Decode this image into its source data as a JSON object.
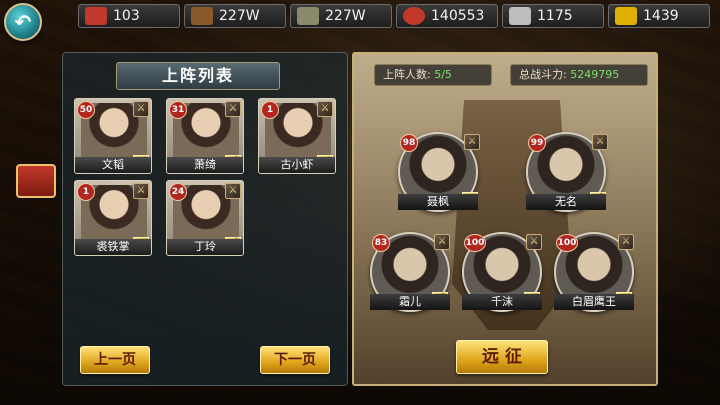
{
  "resources": [
    {
      "icon": "scroll-icon",
      "color": "#c0392b",
      "value": "103"
    },
    {
      "icon": "wood-icon",
      "color": "#8b5a2b",
      "value": "227W"
    },
    {
      "icon": "stone-icon",
      "color": "#8a8a6a",
      "value": "227W"
    },
    {
      "icon": "meat-icon",
      "color": "#c0392b",
      "value": "140553"
    },
    {
      "icon": "silver-ingot-icon",
      "color": "#bdbdbd",
      "value": "1175"
    },
    {
      "icon": "gold-ingot-icon",
      "color": "#e0b000",
      "value": "1439"
    }
  ],
  "left_panel": {
    "title": "上阵列表",
    "prev_page": "上一页",
    "next_page": "下一页",
    "heroes": [
      {
        "name": "文韬",
        "level": "50"
      },
      {
        "name": "萧绮",
        "level": "31"
      },
      {
        "name": "古小虾",
        "level": "1"
      },
      {
        "name": "裘铁掌",
        "level": "1"
      },
      {
        "name": "丁玲",
        "level": "24"
      }
    ]
  },
  "right_panel": {
    "lineup_label": "上阵人数:",
    "lineup_value": "5/5",
    "power_label": "总战斗力:",
    "power_value": "5249795",
    "expedition": "远 征",
    "team": [
      {
        "name": "聂枫",
        "level": "98"
      },
      {
        "name": "无名",
        "level": "99"
      },
      {
        "name": "霜儿",
        "level": "83"
      },
      {
        "name": "千沫",
        "level": "100"
      },
      {
        "name": "白眉鹰王",
        "level": "100"
      }
    ]
  }
}
